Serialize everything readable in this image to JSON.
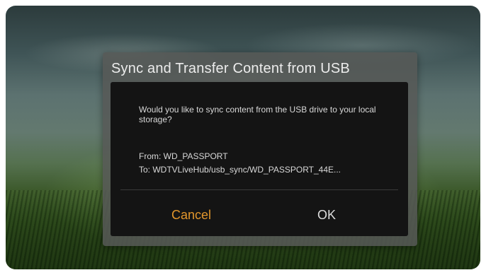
{
  "dialog": {
    "title": "Sync and Transfer Content from USB",
    "message": "Would you like to sync content from the USB drive to your local storage?",
    "from": "From: WD_PASSPORT",
    "to": "To: WDTVLiveHub/usb_sync/WD_PASSPORT_44E..."
  },
  "buttons": {
    "cancel": "Cancel",
    "ok": "OK"
  },
  "colors": {
    "accent_selected": "#e2962c",
    "button_text": "#dcdcdc"
  }
}
